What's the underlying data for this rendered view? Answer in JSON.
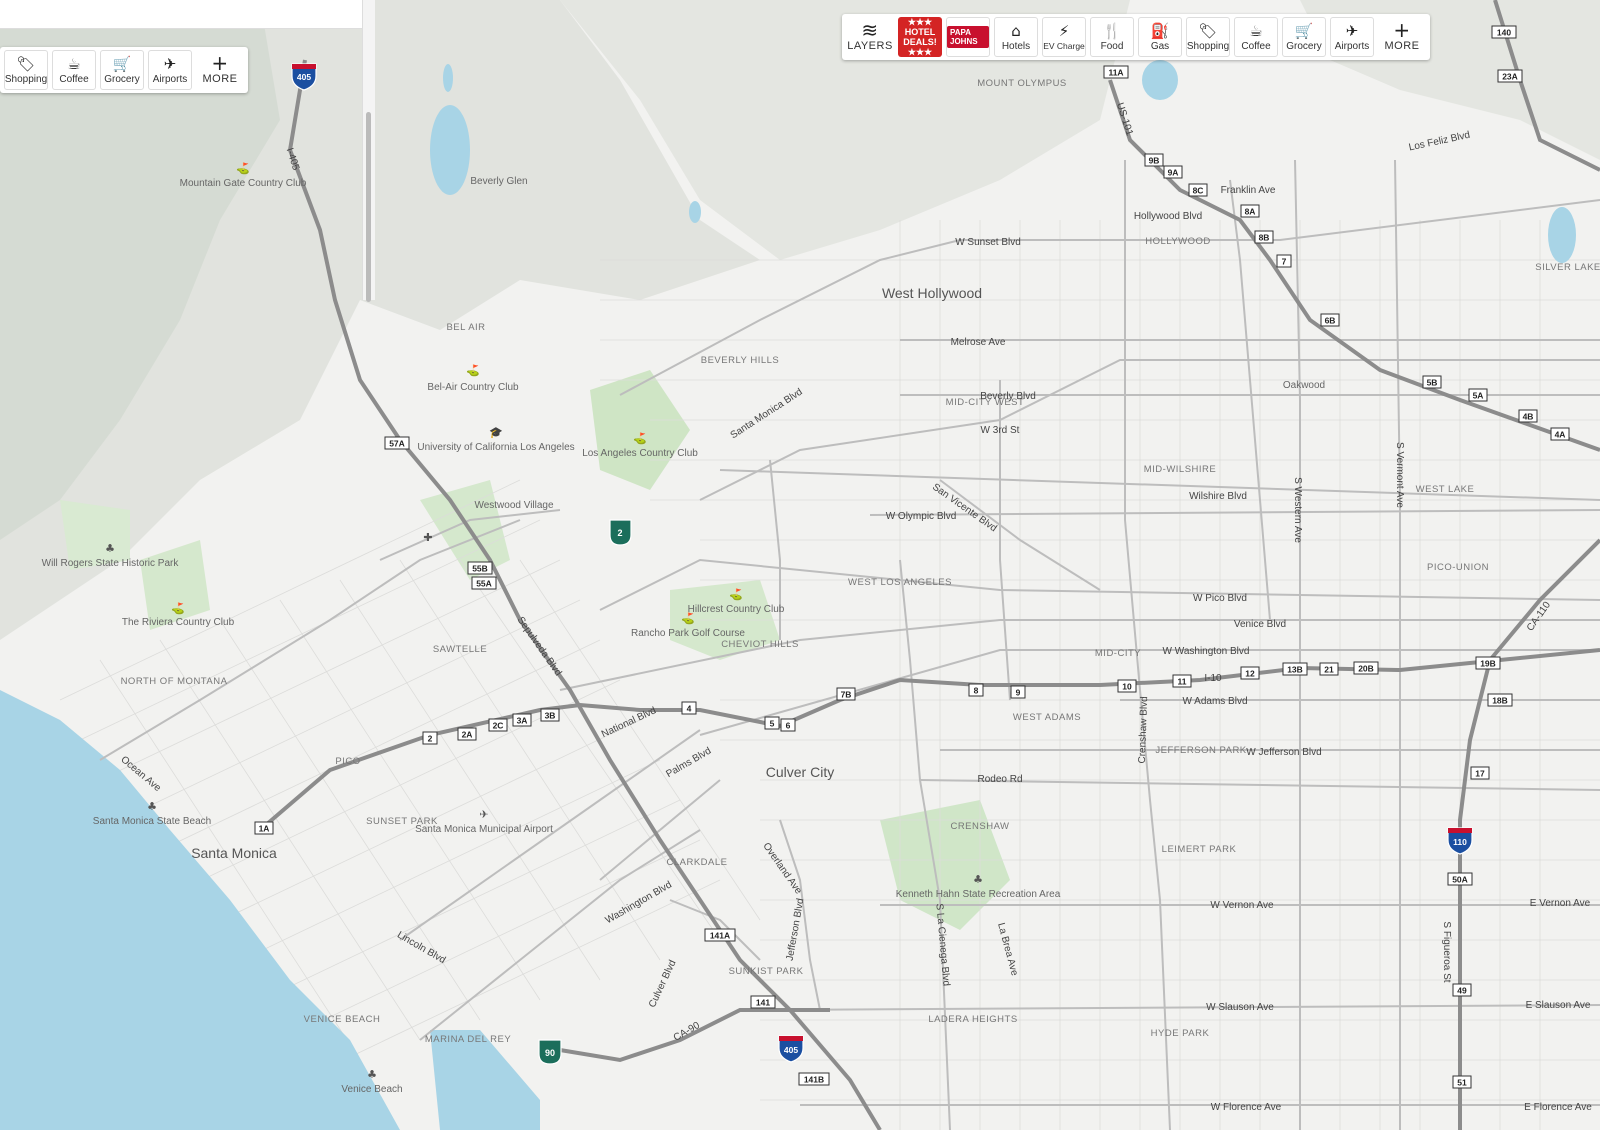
{
  "top_toolbar": {
    "items": [
      {
        "label": "LAYERS",
        "icon": "layers-icon",
        "glyph": "≋"
      },
      {
        "label": "HOTEL DEALS!",
        "icon": "hotel-deals-logo"
      },
      {
        "label": "PAPA JOHNS",
        "icon": "papa-johns-logo"
      },
      {
        "label": "Hotels",
        "icon": "hotel-icon",
        "glyph": "⌂"
      },
      {
        "label": "EV Charge",
        "icon": "ev-charge-icon",
        "glyph": "⚡"
      },
      {
        "label": "Food",
        "icon": "food-icon",
        "glyph": "🍴"
      },
      {
        "label": "Gas",
        "icon": "gas-icon",
        "glyph": "⛽"
      },
      {
        "label": "Shopping",
        "icon": "shopping-tag-icon",
        "glyph": "🏷"
      },
      {
        "label": "Coffee",
        "icon": "coffee-icon",
        "glyph": "☕"
      },
      {
        "label": "Grocery",
        "icon": "grocery-cart-icon",
        "glyph": "🛒"
      },
      {
        "label": "Airports",
        "icon": "airport-icon",
        "glyph": "✈"
      },
      {
        "label": "MORE",
        "icon": "plus-icon",
        "glyph": "+"
      }
    ]
  },
  "left_toolbar": {
    "items": [
      {
        "label": "Shopping",
        "icon": "shopping-tag-icon",
        "glyph": "🏷"
      },
      {
        "label": "Coffee",
        "icon": "coffee-icon",
        "glyph": "☕"
      },
      {
        "label": "Grocery",
        "icon": "grocery-cart-icon",
        "glyph": "🛒"
      },
      {
        "label": "Airports",
        "icon": "airport-icon",
        "glyph": "✈"
      },
      {
        "label": "MORE",
        "icon": "plus-icon",
        "glyph": "+"
      }
    ]
  },
  "map": {
    "water_color": "#a8d4e6",
    "land_color": "#f1f1ef",
    "park_color": "#d4e8cc",
    "city_labels": [
      "West Hollywood",
      "Culver City",
      "Santa Monica"
    ],
    "area_labels": [
      "BEL AIR",
      "BEVERLY HILLS",
      "MID-CITY WEST",
      "HOLLYWOOD",
      "MID-WILSHIRE",
      "WEST LAKE",
      "PICO-UNION",
      "WEST LOS ANGELES",
      "SAWTELLE",
      "NORTH OF MONTANA",
      "CHEVIOT HILLS",
      "MID-CITY",
      "WEST ADAMS",
      "JEFFERSON PARK",
      "CRENSHAW",
      "LEIMERT PARK",
      "SUNSET PARK",
      "CLARKDALE",
      "SUNKIST PARK",
      "LADERA HEIGHTS",
      "HYDE PARK",
      "VENICE BEACH",
      "MARINA DEL REY",
      "PICO",
      "MOUNT OLYMPUS",
      "SILVER LAKE",
      "Westwood Village",
      "Beverly Glen",
      "Oakwood"
    ],
    "road_labels": [
      "W Sunset Blvd",
      "Melrose Ave",
      "Beverly Blvd",
      "W 3rd St",
      "Wilshire Blvd",
      "W Olympic Blvd",
      "W Pico Blvd",
      "Venice Blvd",
      "W Washington Blvd",
      "W Adams Blvd",
      "W Jefferson Blvd",
      "Rodeo Rd",
      "W Vernon Ave",
      "W Slauson Ave",
      "W Florence Ave",
      "Hollywood Blvd",
      "Franklin Ave",
      "Los Feliz Blvd",
      "Santa Monica Blvd",
      "San Vicente Blvd",
      "Sepulveda Blvd",
      "Lincoln Blvd",
      "Ocean Ave",
      "National Blvd",
      "Palms Blvd",
      "Overland Ave",
      "Washington Blvd",
      "Culver Blvd",
      "Jefferson Blvd",
      "Crenshaw Blvd",
      "La Brea Ave",
      "S La Cienega Blvd",
      "S Western Ave",
      "S Vermont Ave",
      "S Figueroa St",
      "E Vernon Ave",
      "E Slauson Ave",
      "E Florence Ave",
      "I-405",
      "I-10",
      "US-101",
      "CA-110",
      "CA-90"
    ],
    "poi_labels": [
      "Mountain Gate Country Club",
      "Bel-Air Country Club",
      "University of California Los Angeles",
      "Los Angeles Country Club",
      "Will Rogers State Historic Park",
      "The Riviera Country Club",
      "Hillcrest Country Club",
      "Rancho Park Golf Course",
      "Santa Monica State Beach",
      "Santa Monica Municipal Airport",
      "Kenneth Hahn State Recreation Area",
      "Venice Beach"
    ],
    "shields": [
      "405",
      "2",
      "90",
      "110",
      "405"
    ],
    "exits": [
      "11A",
      "9B",
      "9A",
      "8C",
      "8A",
      "8B",
      "7",
      "6B",
      "5B",
      "5A",
      "4B",
      "4A",
      "57A",
      "55B",
      "55A",
      "3B",
      "3A",
      "2C",
      "2A",
      "2",
      "1A",
      "4",
      "5",
      "6",
      "7B",
      "8",
      "9",
      "10",
      "11",
      "12",
      "13B",
      "21",
      "20B",
      "19B",
      "18B",
      "17",
      "50A",
      "49",
      "51",
      "141",
      "141B",
      "141A",
      "140",
      "23A"
    ]
  }
}
